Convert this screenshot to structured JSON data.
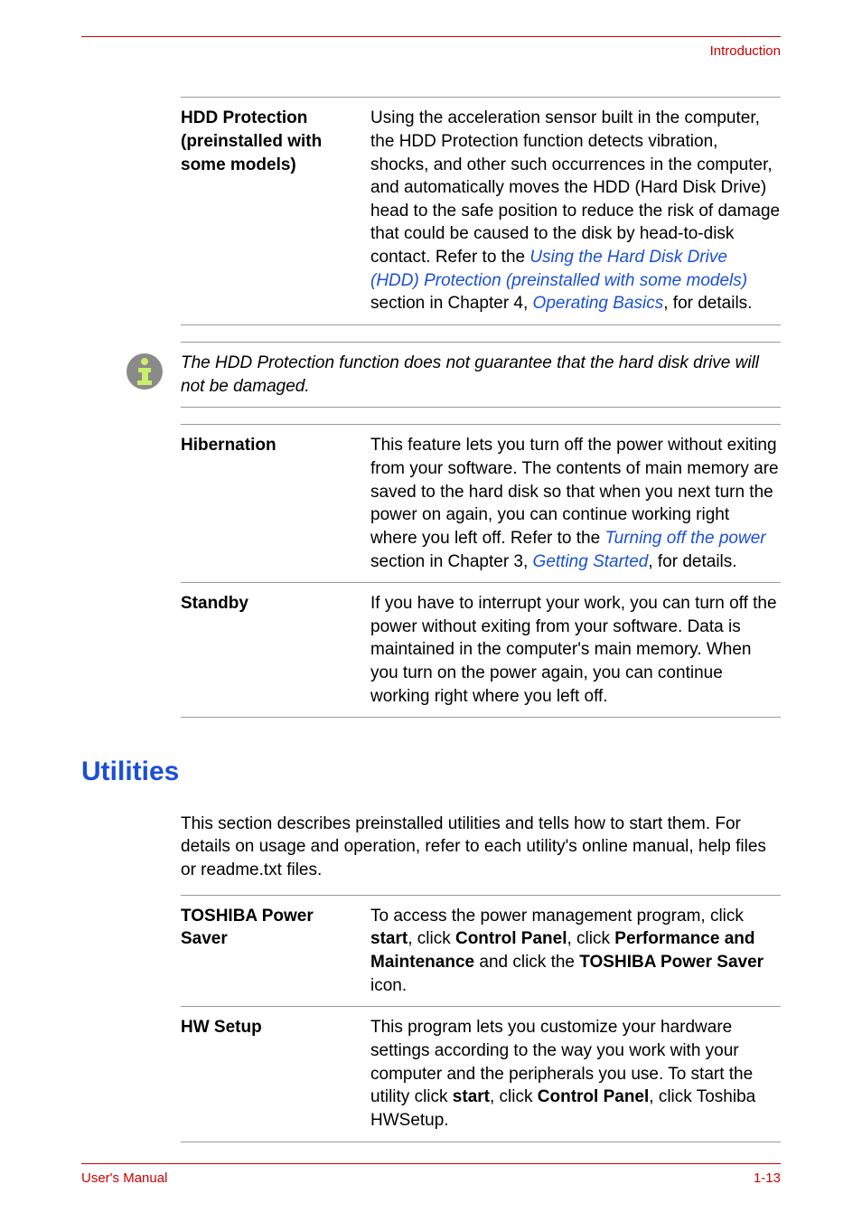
{
  "topLabel": "Introduction",
  "rows1": [
    {
      "label": "HDD Protection (preinstalled with some models)",
      "body_pre": "Using the acceleration sensor built in the computer, the HDD Protection function detects vibration, shocks, and other such occurrences in the computer, and automatically moves the HDD (Hard Disk Drive) head to the safe position to reduce the risk of damage that could be caused to the disk by head-to-disk contact. Refer to the ",
      "link1": "Using the Hard Disk Drive (HDD) Protection (preinstalled with some models)",
      "mid1": " section in Chapter 4, ",
      "link2": "Operating Basics",
      "tail": ", for details."
    }
  ],
  "note": "The HDD Protection function does not guarantee that the hard disk drive will not be damaged.",
  "rows2": [
    {
      "label": "Hibernation",
      "body_pre": "This feature lets you turn off the power without exiting from your software. The contents of main memory are saved to the hard disk so that when you next turn the power on again, you can continue working right where you left off. Refer to the ",
      "link1": "Turning off the power",
      "mid1": " section in Chapter 3, ",
      "link2": "Getting Started",
      "tail": ", for details."
    },
    {
      "label": "Standby",
      "body_pre": "If you have to interrupt your work, you can turn off the power without exiting from your software. Data is maintained in the computer's main memory. When you turn on the power again, you can continue working right where you left off.",
      "link1": "",
      "mid1": "",
      "link2": "",
      "tail": ""
    }
  ],
  "sectionHeading": "Utilities",
  "sectionIntro": "This section describes preinstalled utilities and tells how to start them. For details on usage and operation, refer to each utility's online manual, help files or readme.txt files.",
  "rows3": [
    {
      "label": "TOSHIBA Power Saver",
      "p1": "To access the power management program, click ",
      "b1": "start",
      "p2": ", click ",
      "b2": "Control Panel",
      "p3": ", click ",
      "b3": "Performance and Maintenance",
      "p4": " and click the ",
      "b4": "TOSHIBA Power Saver",
      "p5": " icon."
    },
    {
      "label": "HW Setup",
      "p1": "This program lets you customize your hardware settings according to the way you work with your computer and the peripherals you use. To start the utility click ",
      "b1": "start",
      "p2": ", click ",
      "b2": "Control Panel",
      "p3": ", click Toshiba HWSetup.",
      "b3": "",
      "p4": "",
      "b4": "",
      "p5": ""
    }
  ],
  "footerLeft": "User's Manual",
  "footerRight": "1-13",
  "chart_data": null
}
